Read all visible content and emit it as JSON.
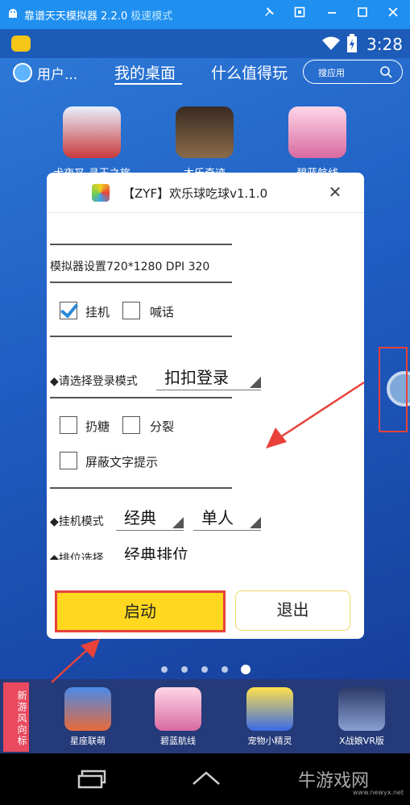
{
  "titlebar": {
    "title": "靠谱天天模拟器 2.2.0",
    "mode": "极速模式"
  },
  "status": {
    "time": "3:28"
  },
  "nav": {
    "user": "用户...",
    "tab_desktop": "我的桌面",
    "tab_worth": "什么值得玩",
    "search_placeholder": "搜应用"
  },
  "desktop_apps": [
    {
      "label": "犬夜叉-寻玉之旅"
    },
    {
      "label": "木乐奇迹"
    },
    {
      "label": "碧蓝航线"
    }
  ],
  "dialog": {
    "title": "【ZYF】欢乐球吃球v1.1.0",
    "emulator_setting": "模拟器设置720*1280 DPI 320",
    "cb_afk": "挂机",
    "cb_shout": "喊话",
    "login_mode_label": "◆请选择登录模式",
    "login_mode_value": "扣扣登录",
    "cb_throw_candy": "扔糖",
    "cb_split": "分裂",
    "cb_mask_text": "屏蔽文字提示",
    "afk_mode_label": "◆挂机模式",
    "afk_mode_value": "经典",
    "afk_mode_value2": "单人",
    "rank_label": "◆排位选择",
    "rank_value": "经典排位",
    "start": "启动",
    "exit": "退出"
  },
  "checkbox_state": {
    "afk": true,
    "shout": false,
    "throw_candy": false,
    "split": false,
    "mask_text": false
  },
  "dock": {
    "tag": "新游风向标",
    "apps": [
      {
        "label": "星座联萌"
      },
      {
        "label": "碧蓝航线"
      },
      {
        "label": "宠物小精灵"
      },
      {
        "label": "X战娘VR版"
      }
    ]
  },
  "watermark": {
    "brand": "牛游戏网",
    "url": "www.newyx.net"
  },
  "colors": {
    "titlebar": "#1f8ff0",
    "accent_red": "#e8423a",
    "start_button": "#ffd81f",
    "check": "#2a88d8"
  }
}
